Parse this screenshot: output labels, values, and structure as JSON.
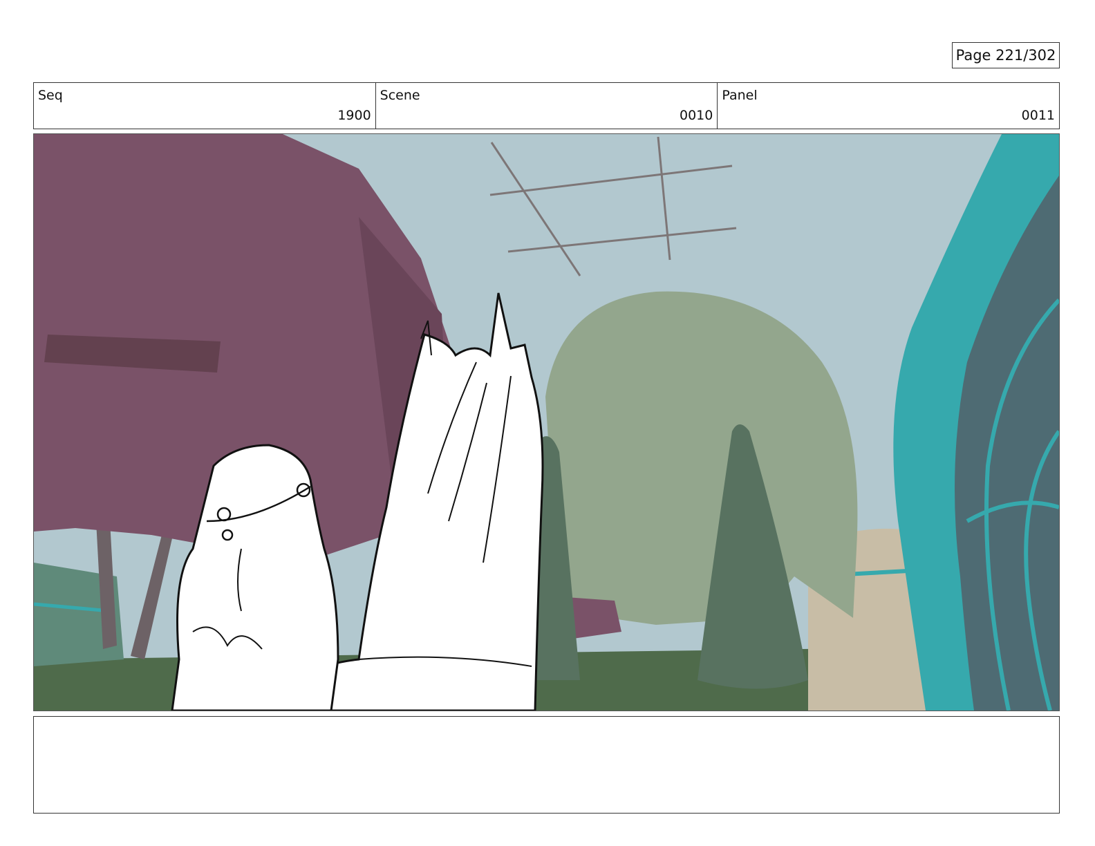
{
  "page": {
    "number_label": "Page 221/302"
  },
  "header": {
    "seq": {
      "label": "Seq",
      "value": "1900"
    },
    "scene": {
      "label": "Scene",
      "value": "0010"
    },
    "panel": {
      "label": "Panel",
      "value": "0011"
    }
  },
  "colors": {
    "sky": "#b2c8cf",
    "purple_tree": "#7a5268",
    "green_dome": "#93a68d",
    "cypress": "#587260",
    "teal_arch": "#36a9ad",
    "ground": "#4f6b4b"
  },
  "notes": {
    "text": ""
  }
}
